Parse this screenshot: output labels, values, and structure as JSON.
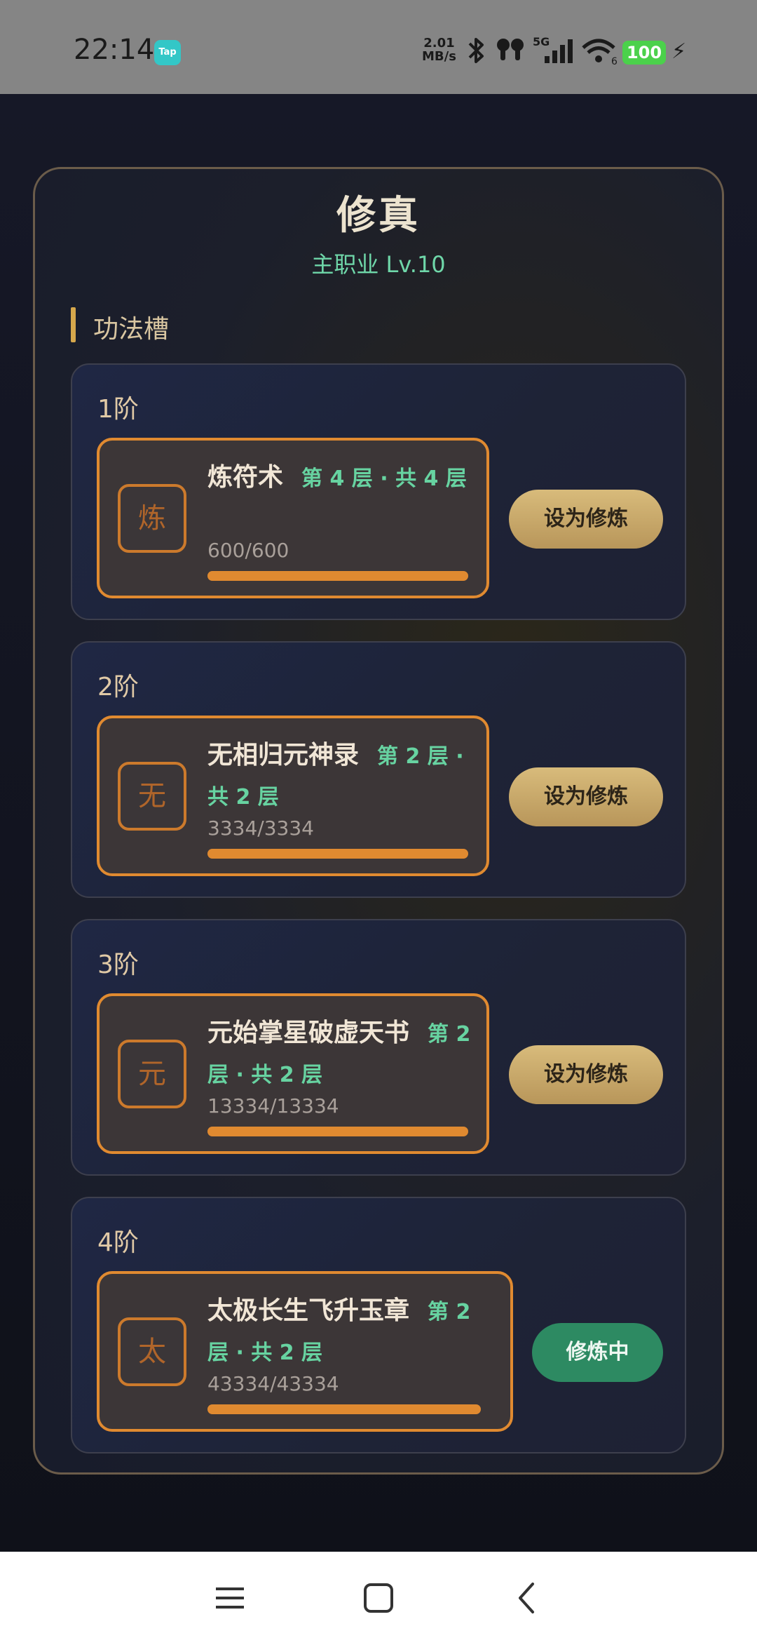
{
  "status_bar": {
    "time": "22:14",
    "app_badge": "Tap",
    "net_speed_value": "2.01",
    "net_speed_unit": "MB/s",
    "network": "5G",
    "battery": "100"
  },
  "header": {
    "title": "修真",
    "subtitle": "主职业 Lv.10"
  },
  "section": {
    "title": "功法槽"
  },
  "tiers": [
    {
      "label": "1阶",
      "skill": {
        "icon_char": "炼",
        "name": "炼符术",
        "layer": "第 4 层 · 共 4 层",
        "progress_text": "600/600",
        "progress": 1.0
      },
      "button": "设为修炼"
    },
    {
      "label": "2阶",
      "skill": {
        "icon_char": "无",
        "name": "无相归元神录",
        "layer": "第 2 层 · 共 2 层",
        "progress_text": "3334/3334",
        "progress": 1.0
      },
      "button": "设为修炼"
    },
    {
      "label": "3阶",
      "skill": {
        "icon_char": "元",
        "name": "元始掌星破虚天书",
        "layer": "第 2 层 · 共 2 层",
        "progress_text": "13334/13334",
        "progress": 1.0
      },
      "button": "设为修炼"
    },
    {
      "label": "4阶",
      "skill": {
        "icon_char": "太",
        "name": "太极长生飞升玉章",
        "layer": "第 2 层 · 共 2 层",
        "progress_text": "43334/43334",
        "progress": 1.0
      },
      "button": "修炼中"
    }
  ],
  "colors": {
    "accent_gold": "#d8bb7b",
    "layer_green": "#67d3a1",
    "card_border": "#e08a30",
    "active_green": "#2d8a62"
  },
  "nav_icons": [
    "menu-icon",
    "home-square-icon",
    "back-chevron-icon"
  ]
}
